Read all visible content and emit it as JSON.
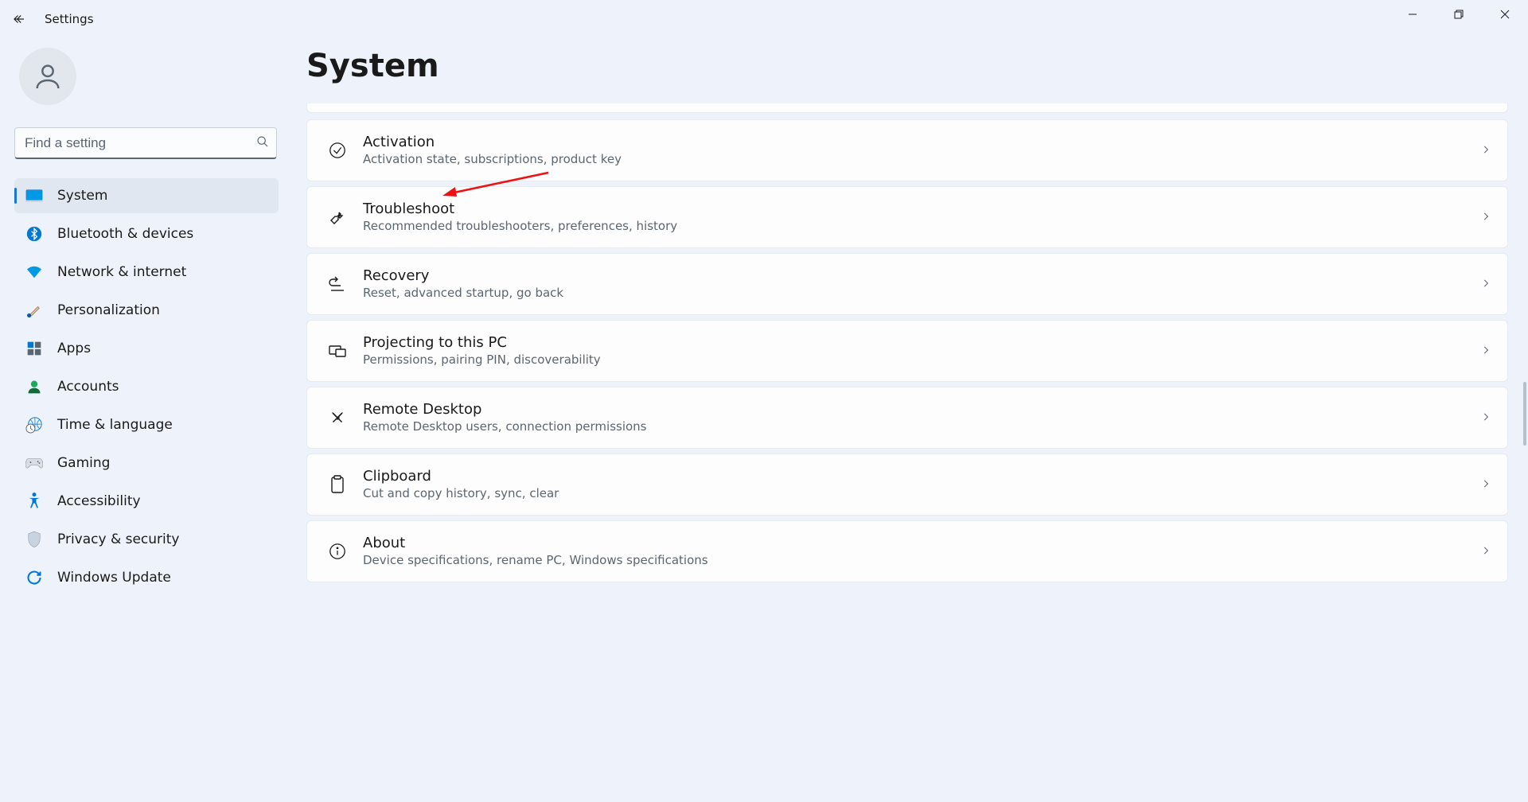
{
  "window": {
    "title": "Settings"
  },
  "search": {
    "placeholder": "Find a setting"
  },
  "nav": {
    "items": [
      {
        "label": "System",
        "icon": "system"
      },
      {
        "label": "Bluetooth & devices",
        "icon": "bluetooth"
      },
      {
        "label": "Network & internet",
        "icon": "wifi"
      },
      {
        "label": "Personalization",
        "icon": "brush"
      },
      {
        "label": "Apps",
        "icon": "apps"
      },
      {
        "label": "Accounts",
        "icon": "accounts"
      },
      {
        "label": "Time & language",
        "icon": "clock-globe"
      },
      {
        "label": "Gaming",
        "icon": "gaming"
      },
      {
        "label": "Accessibility",
        "icon": "accessibility"
      },
      {
        "label": "Privacy & security",
        "icon": "shield"
      },
      {
        "label": "Windows Update",
        "icon": "update"
      }
    ]
  },
  "page": {
    "title": "System"
  },
  "cards": [
    {
      "title": "Activation",
      "sub": "Activation state, subscriptions, product key",
      "icon": "check-circle"
    },
    {
      "title": "Troubleshoot",
      "sub": "Recommended troubleshooters, preferences, history",
      "icon": "wrench"
    },
    {
      "title": "Recovery",
      "sub": "Reset, advanced startup, go back",
      "icon": "recovery-arrow"
    },
    {
      "title": "Projecting to this PC",
      "sub": "Permissions, pairing PIN, discoverability",
      "icon": "project"
    },
    {
      "title": "Remote Desktop",
      "sub": "Remote Desktop users, connection permissions",
      "icon": "remote"
    },
    {
      "title": "Clipboard",
      "sub": "Cut and copy history, sync, clear",
      "icon": "clipboard"
    },
    {
      "title": "About",
      "sub": "Device specifications, rename PC, Windows specifications",
      "icon": "info-circle"
    }
  ]
}
